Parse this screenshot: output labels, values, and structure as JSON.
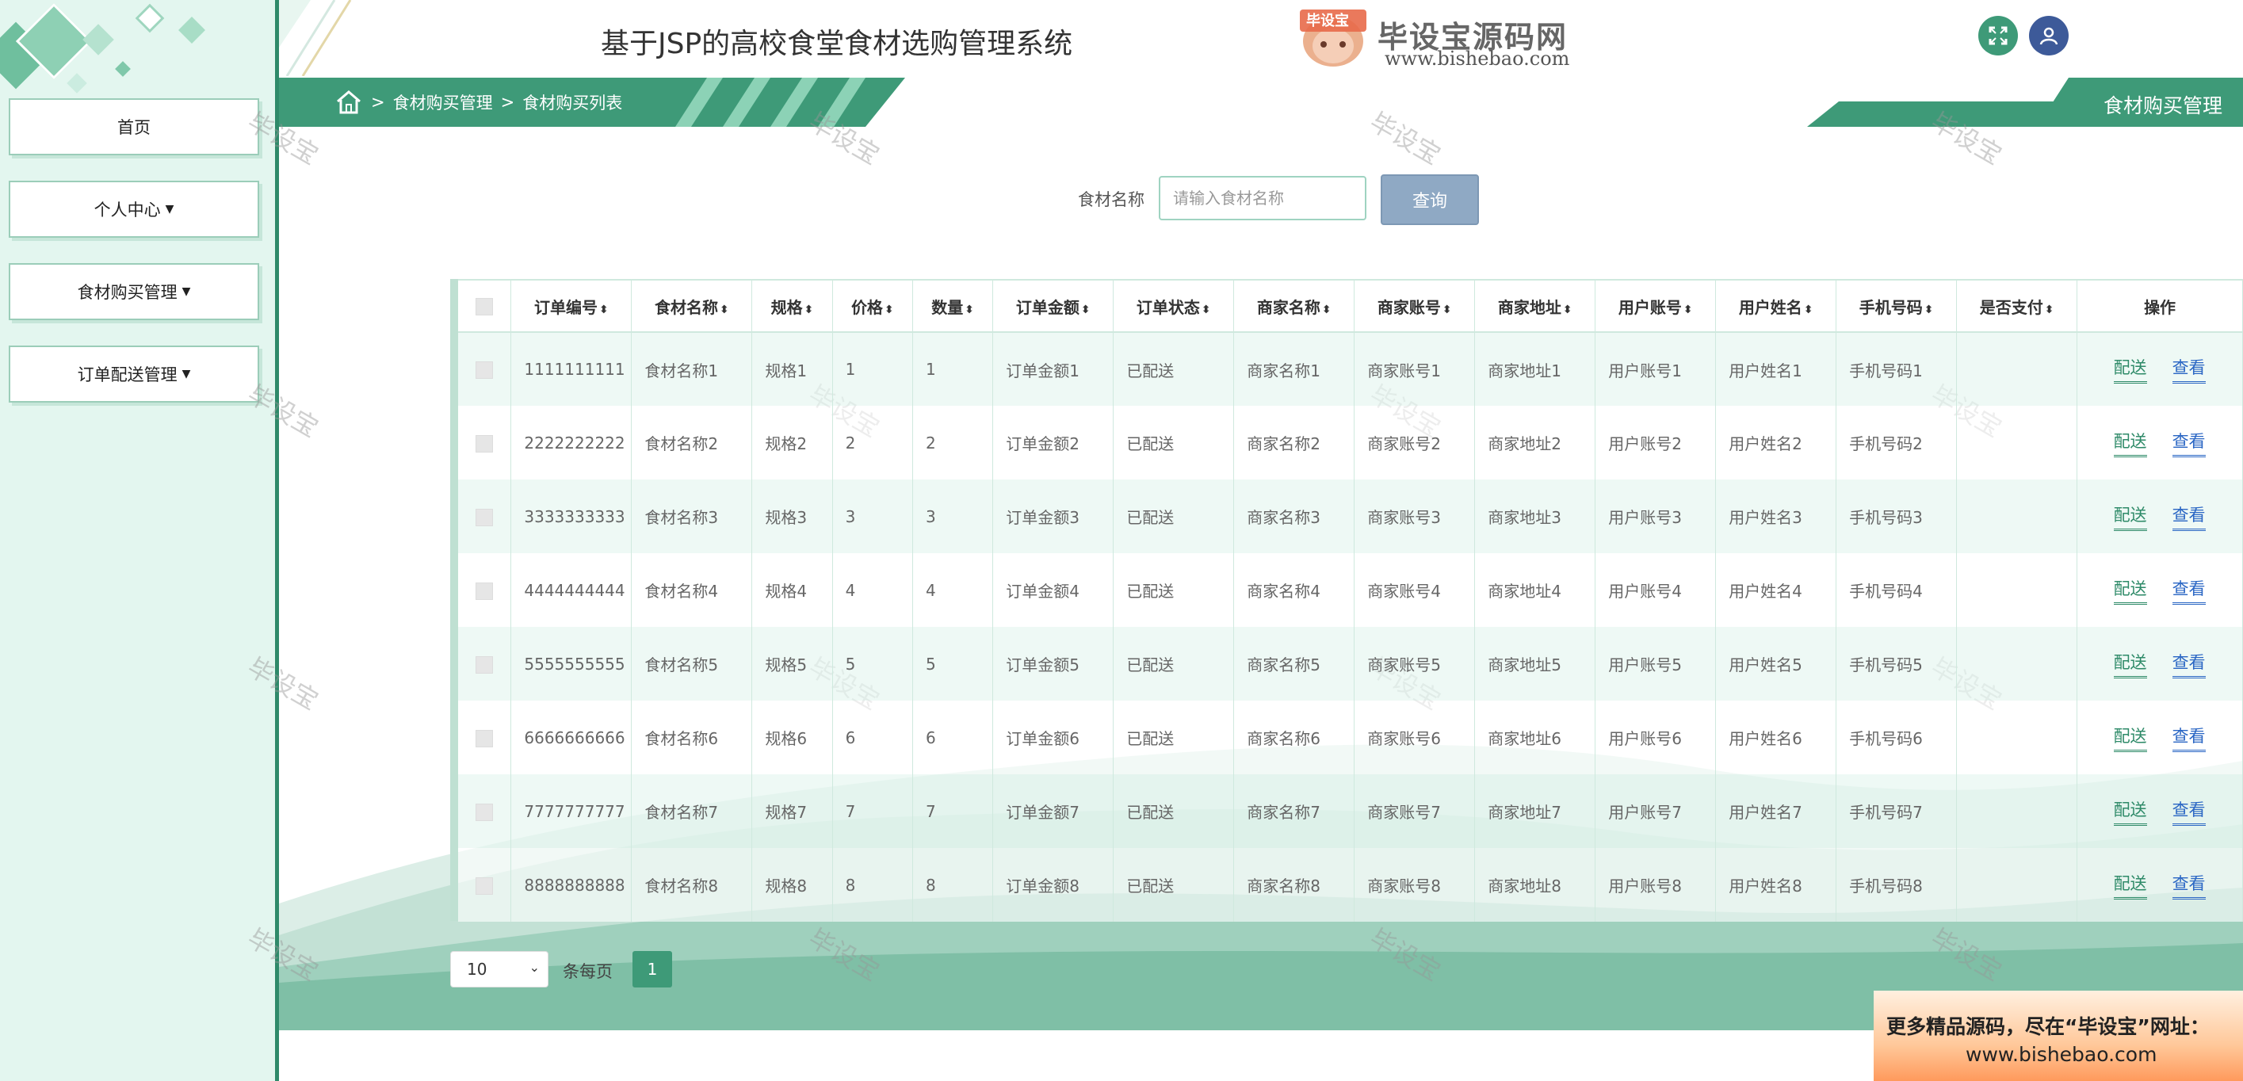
{
  "sidebar": {
    "items": [
      {
        "label": "首页",
        "caret": false
      },
      {
        "label": "个人中心",
        "caret": true
      },
      {
        "label": "食材购买管理",
        "caret": true
      },
      {
        "label": "订单配送管理",
        "caret": true
      }
    ]
  },
  "header": {
    "title": "基于JSP的高校食堂食材选购管理系统",
    "brand_name": "毕设宝源码网",
    "brand_url": "www.bishebao.com",
    "logo_text": "毕设宝"
  },
  "breadcrumb": {
    "items": [
      "食材购买管理",
      "食材购买列表"
    ],
    "separator": ">"
  },
  "page_tag": "食材购买管理",
  "watermark_text": "毕设宝",
  "search": {
    "label": "食材名称",
    "placeholder": "请输入食材名称",
    "value": "",
    "button": "查询"
  },
  "table": {
    "headers": [
      "订单编号",
      "食材名称",
      "规格",
      "价格",
      "数量",
      "订单金额",
      "订单状态",
      "商家名称",
      "商家账号",
      "商家地址",
      "用户账号",
      "用户姓名",
      "手机号码",
      "是否支付",
      "操作"
    ],
    "sort_icon": "⬍",
    "rows": [
      [
        "1111111111",
        "食材名称1",
        "规格1",
        "1",
        "1",
        "订单金额1",
        "已配送",
        "商家名称1",
        "商家账号1",
        "商家地址1",
        "用户账号1",
        "用户姓名1",
        "手机号码1",
        ""
      ],
      [
        "2222222222",
        "食材名称2",
        "规格2",
        "2",
        "2",
        "订单金额2",
        "已配送",
        "商家名称2",
        "商家账号2",
        "商家地址2",
        "用户账号2",
        "用户姓名2",
        "手机号码2",
        ""
      ],
      [
        "3333333333",
        "食材名称3",
        "规格3",
        "3",
        "3",
        "订单金额3",
        "已配送",
        "商家名称3",
        "商家账号3",
        "商家地址3",
        "用户账号3",
        "用户姓名3",
        "手机号码3",
        ""
      ],
      [
        "4444444444",
        "食材名称4",
        "规格4",
        "4",
        "4",
        "订单金额4",
        "已配送",
        "商家名称4",
        "商家账号4",
        "商家地址4",
        "用户账号4",
        "用户姓名4",
        "手机号码4",
        ""
      ],
      [
        "5555555555",
        "食材名称5",
        "规格5",
        "5",
        "5",
        "订单金额5",
        "已配送",
        "商家名称5",
        "商家账号5",
        "商家地址5",
        "用户账号5",
        "用户姓名5",
        "手机号码5",
        ""
      ],
      [
        "6666666666",
        "食材名称6",
        "规格6",
        "6",
        "6",
        "订单金额6",
        "已配送",
        "商家名称6",
        "商家账号6",
        "商家地址6",
        "用户账号6",
        "用户姓名6",
        "手机号码6",
        ""
      ],
      [
        "7777777777",
        "食材名称7",
        "规格7",
        "7",
        "7",
        "订单金额7",
        "已配送",
        "商家名称7",
        "商家账号7",
        "商家地址7",
        "用户账号7",
        "用户姓名7",
        "手机号码7",
        ""
      ],
      [
        "8888888888",
        "食材名称8",
        "规格8",
        "8",
        "8",
        "订单金额8",
        "已配送",
        "商家名称8",
        "商家账号8",
        "商家地址8",
        "用户账号8",
        "用户姓名8",
        "手机号码8",
        ""
      ]
    ],
    "actions": [
      "配送",
      "查看"
    ]
  },
  "pagination": {
    "page_size": "10",
    "per_page_label": "条每页",
    "current_page": "1"
  },
  "promo": {
    "line1": "更多精品源码，尽在“毕设宝”网址：",
    "line2": "www.bishebao.com"
  },
  "colors": {
    "primary": "#3e9a78",
    "sidebar_bg": "#e3f6ef",
    "dispatch_link": "#2e8a68",
    "view_link": "#2a66c4",
    "search_button": "#8fa9c4"
  }
}
